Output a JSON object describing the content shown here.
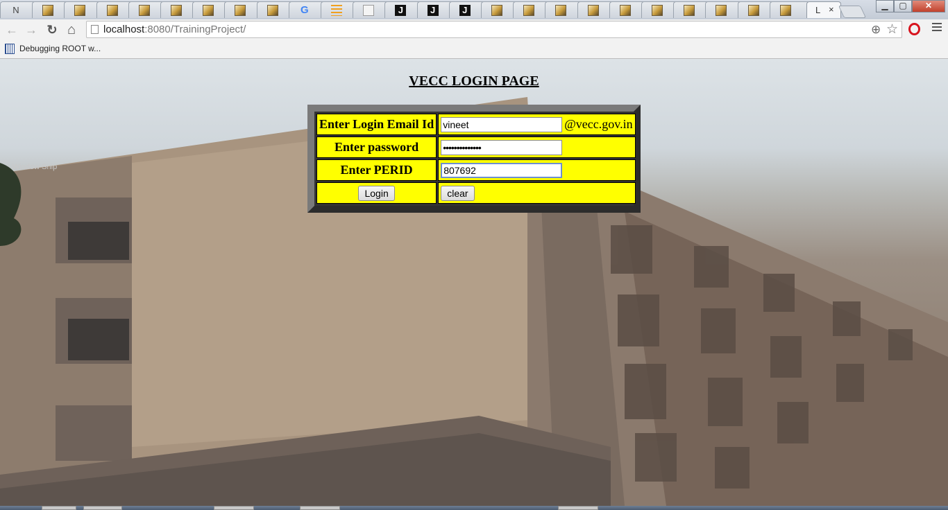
{
  "browser": {
    "tabs": [
      {
        "icon": "n-letter-icon",
        "glyph": "N"
      },
      {
        "icon": "image-favicon"
      },
      {
        "icon": "image-favicon"
      },
      {
        "icon": "image-favicon"
      },
      {
        "icon": "image-favicon"
      },
      {
        "icon": "image-favicon"
      },
      {
        "icon": "image-favicon"
      },
      {
        "icon": "image-favicon"
      },
      {
        "icon": "image-favicon"
      },
      {
        "icon": "google-favicon",
        "glyph": "G"
      },
      {
        "icon": "menu-favicon"
      },
      {
        "icon": "document-favicon"
      },
      {
        "icon": "j-favicon",
        "glyph": "J"
      },
      {
        "icon": "j-favicon",
        "glyph": "J"
      },
      {
        "icon": "j-favicon",
        "glyph": "J"
      },
      {
        "icon": "image-favicon"
      },
      {
        "icon": "image-favicon"
      },
      {
        "icon": "image-favicon"
      },
      {
        "icon": "image-favicon"
      },
      {
        "icon": "image-favicon"
      },
      {
        "icon": "image-favicon"
      },
      {
        "icon": "image-favicon"
      },
      {
        "icon": "image-favicon"
      },
      {
        "icon": "image-favicon"
      },
      {
        "icon": "image-favicon"
      }
    ],
    "active_tab": {
      "title": "L",
      "close": "×"
    },
    "window_controls": {
      "minimize": "▁",
      "maximize": "▢",
      "close": "✕"
    },
    "nav": {
      "back": "←",
      "forward": "→",
      "reload": "↻",
      "home": "⌂"
    },
    "address": {
      "host": "localhost",
      "rest": ":8080/TrainingProject/"
    },
    "omnibox_icons": {
      "zoom": "⊕",
      "star": "☆"
    },
    "bookmarks": [
      {
        "label": "Debugging ROOT w..."
      }
    ]
  },
  "page": {
    "title": "VECC LOGIN PAGE",
    "watermark": "Window Snip",
    "form": {
      "email_label": "Enter Login Email Id",
      "email_value": "vineet",
      "email_suffix": "@vecc.gov.in",
      "password_label": "Enter password",
      "password_mask": "••••••••••••••",
      "perid_label": "Enter PERID",
      "perid_value": "807692",
      "login_button": "Login",
      "clear_button": "clear"
    }
  },
  "colors": {
    "form_cell": "#ffff00",
    "form_frame": "#333333",
    "title_text": "#000000"
  }
}
